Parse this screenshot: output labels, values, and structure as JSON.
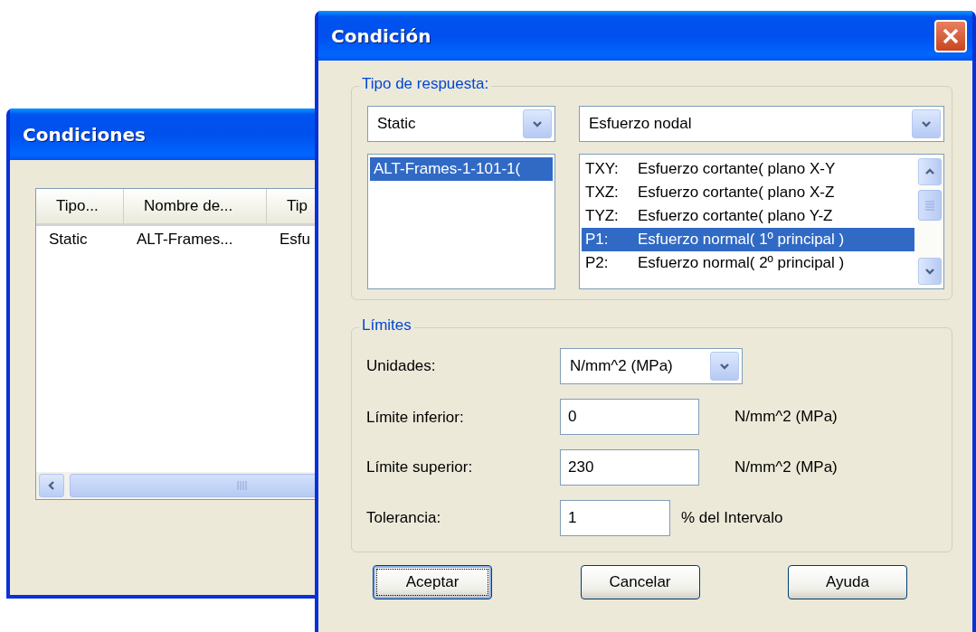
{
  "back_window": {
    "title": "Condiciones",
    "list": {
      "columns": [
        "Tipo...",
        "Nombre de...",
        "Tip"
      ],
      "rows": [
        {
          "cells": [
            "Static",
            "ALT-Frames...",
            "Esfu"
          ],
          "selected": false
        }
      ]
    }
  },
  "dialog": {
    "title": "Condición",
    "response_group": {
      "label": "Tipo de respuesta:",
      "analysis_combo": {
        "value": "Static"
      },
      "result_combo": {
        "value": "Esfuerzo nodal"
      },
      "cases": [
        {
          "label": "ALT-Frames-1-101-1(",
          "selected": true
        }
      ],
      "components": [
        {
          "code": "TXY:",
          "description": "Esfuerzo cortante( plano X-Y",
          "selected": false
        },
        {
          "code": "TXZ:",
          "description": "Esfuerzo cortante( plano X-Z",
          "selected": false
        },
        {
          "code": "TYZ:",
          "description": "Esfuerzo cortante( plano Y-Z",
          "selected": false
        },
        {
          "code": "P1:",
          "description": "Esfuerzo normal( 1º principal )",
          "selected": true
        },
        {
          "code": "P2:",
          "description": "Esfuerzo normal( 2º principal )",
          "selected": false
        }
      ]
    },
    "limits_group": {
      "label": "Límites",
      "units": {
        "label": "Unidades:",
        "value": "N/mm^2 (MPa)"
      },
      "fields": [
        {
          "label": "Límite inferior:",
          "value": "0",
          "unit": "N/mm^2 (MPa)"
        },
        {
          "label": "Límite superior:",
          "value": "230",
          "unit": "N/mm^2 (MPa)"
        },
        {
          "label": "Tolerancia:",
          "value": "1",
          "unit": "% del Intervalo"
        }
      ]
    },
    "buttons": [
      {
        "label": "Aceptar",
        "focused": true
      },
      {
        "label": "Cancelar",
        "focused": false
      },
      {
        "label": "Ayuda",
        "focused": false
      }
    ]
  }
}
